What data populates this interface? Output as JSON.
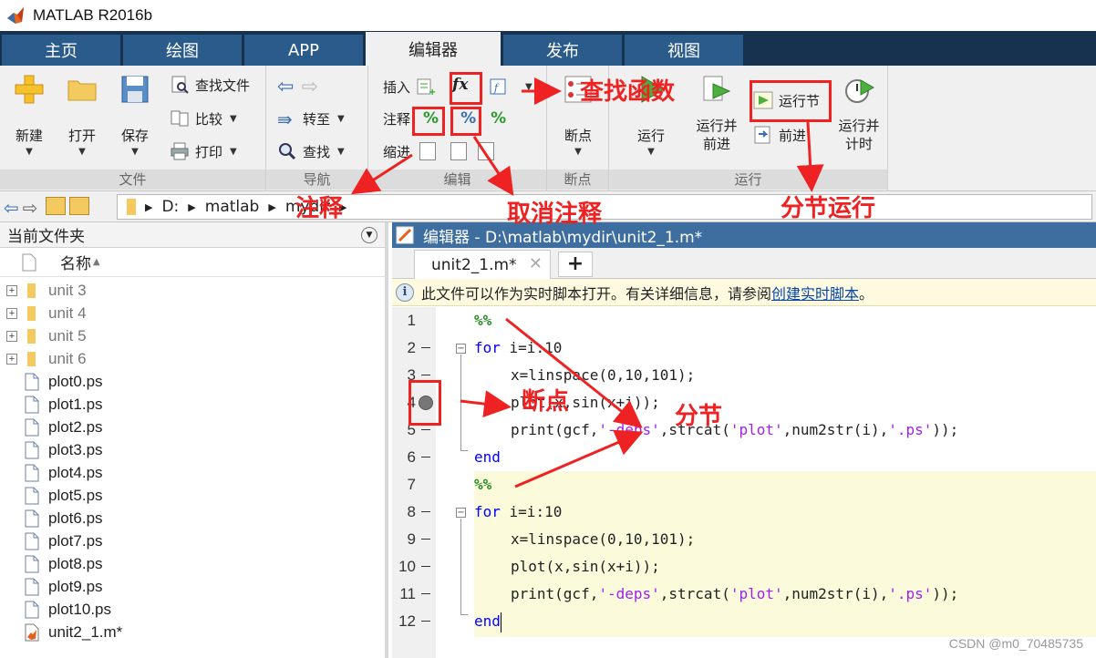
{
  "window": {
    "title": "MATLAB R2016b"
  },
  "tabs": [
    {
      "label": "主页"
    },
    {
      "label": "绘图"
    },
    {
      "label": "APP"
    },
    {
      "label": "编辑器"
    },
    {
      "label": "发布"
    },
    {
      "label": "视图"
    }
  ],
  "ribbon": {
    "file": {
      "label": "文件",
      "new": "新建",
      "open": "打开",
      "save": "保存",
      "find_files": "查找文件",
      "compare": "比较",
      "print": "打印"
    },
    "navigate": {
      "label": "导航",
      "goto": "转至",
      "find": "查找"
    },
    "edit": {
      "label": "编辑",
      "insert": "插入",
      "comment": "注释",
      "indent": "缩进",
      "fx": "fx"
    },
    "breakpoints": {
      "label": "断点",
      "button": "断点"
    },
    "run": {
      "label": "运行",
      "run": "运行",
      "run_advance": "运行并\n前进",
      "run_section": "运行节",
      "advance": "前进",
      "run_time": "运行并\n计时"
    }
  },
  "address": {
    "parts": [
      "D:",
      "matlab",
      "mydir"
    ]
  },
  "current_folder": {
    "title": "当前文件夹",
    "column_name": "名称",
    "items": [
      {
        "name": "unit 3",
        "type": "folder"
      },
      {
        "name": "unit 4",
        "type": "folder"
      },
      {
        "name": "unit 5",
        "type": "folder"
      },
      {
        "name": "unit 6",
        "type": "folder"
      },
      {
        "name": "plot0.ps",
        "type": "file"
      },
      {
        "name": "plot1.ps",
        "type": "file"
      },
      {
        "name": "plot2.ps",
        "type": "file"
      },
      {
        "name": "plot3.ps",
        "type": "file"
      },
      {
        "name": "plot4.ps",
        "type": "file"
      },
      {
        "name": "plot5.ps",
        "type": "file"
      },
      {
        "name": "plot6.ps",
        "type": "file"
      },
      {
        "name": "plot7.ps",
        "type": "file"
      },
      {
        "name": "plot8.ps",
        "type": "file"
      },
      {
        "name": "plot9.ps",
        "type": "file"
      },
      {
        "name": "plot10.ps",
        "type": "file"
      },
      {
        "name": "unit2_1.m*",
        "type": "mfile"
      }
    ]
  },
  "editor": {
    "header": "编辑器 - D:\\matlab\\mydir\\unit2_1.m*",
    "file_tab": "unit2_1.m*",
    "info_text": "此文件可以作为实时脚本打开。有关详细信息，请参阅 ",
    "info_link": "创建实时脚本",
    "info_end": "。",
    "lines": [
      {
        "n": "1",
        "dash": false
      },
      {
        "n": "2",
        "dash": true
      },
      {
        "n": "3",
        "dash": true
      },
      {
        "n": "4",
        "dash": false,
        "breakpoint": true
      },
      {
        "n": "5",
        "dash": true
      },
      {
        "n": "6",
        "dash": true
      },
      {
        "n": "7",
        "dash": false
      },
      {
        "n": "8",
        "dash": true
      },
      {
        "n": "9",
        "dash": true
      },
      {
        "n": "10",
        "dash": true
      },
      {
        "n": "11",
        "dash": true
      },
      {
        "n": "12",
        "dash": true
      }
    ]
  },
  "annotations": {
    "find_function": "查找函数",
    "comment": "注释",
    "uncomment": "取消注释",
    "run_section": "分节运行",
    "breakpoint": "断点",
    "section": "分节"
  },
  "watermark": "CSDN @m0_70485735",
  "colors": {
    "accent_red": "#ee2222",
    "tab_bar": "#16324e",
    "editor_header": "#3e6e9f",
    "cell_highlight": "#fbfbdc"
  }
}
